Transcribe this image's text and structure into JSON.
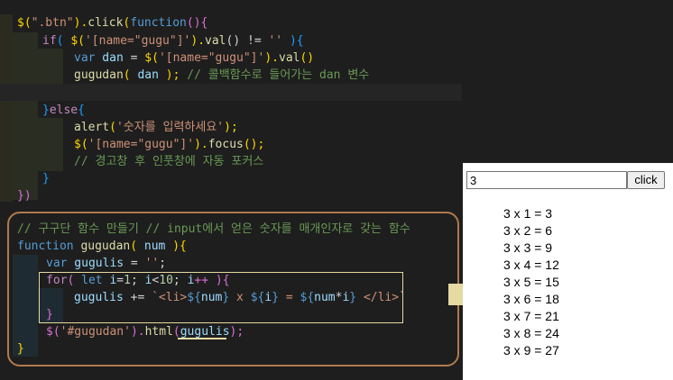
{
  "code": {
    "l1": {
      "p1": "$(",
      "p2": "\".btn\"",
      "p3": ").",
      "p4": "click",
      "p5": "(",
      "p6": "function",
      "p7": "(){"
    },
    "l2": {
      "p1": "if",
      "p2": "( ",
      "p3": "$(",
      "p4": "'[name=\"gugu\"]'",
      "p5": ").",
      "p6": "val",
      "p7": "() != ",
      "p8": "''",
      "p9": " ){"
    },
    "l3": {
      "p1": "var",
      "p2": " dan",
      "p3": " = ",
      "p4": "$(",
      "p5": "'[name=\"gugu\"]'",
      "p6": ").",
      "p7": "val",
      "p8": "()"
    },
    "l4": {
      "p1": "gugudan",
      "p2": "( ",
      "p3": "dan",
      "p4": " ); ",
      "p5": "// 콜백함수로 들어가는 dan 변수"
    },
    "l6": {
      "p1": "}",
      "p2": "else",
      "p3": "{"
    },
    "l7": {
      "p1": "alert",
      "p2": "(",
      "p3": "'숫자를 입력하세요'",
      "p4": ");"
    },
    "l8": {
      "p1": "$(",
      "p2": "'[name=\"gugu\"]'",
      "p3": ").",
      "p4": "focus",
      "p5": "();"
    },
    "l9": {
      "p1": "// 경고창 후 인풋창에 자동 포커스"
    },
    "l10": {
      "p1": "}"
    },
    "l11": {
      "p1": "})"
    },
    "l13": {
      "p1": "// 구구단 함수 만들기 // input에서 얻은 숫자를 매개인자로 갖는 함수"
    },
    "l14": {
      "p1": "function",
      "p2": " gugudan",
      "p3": "( ",
      "p4": "num",
      "p5": " )",
      "p6": "{"
    },
    "l15": {
      "p1": "var",
      "p2": " gugulis",
      "p3": " = ",
      "p4": "''",
      "p5": ";"
    },
    "l16": {
      "p1": "for",
      "p2": "( ",
      "p3": "let",
      "p4": " i",
      "p5": "=",
      "p6": "1",
      "p7": "; ",
      "p8": "i",
      "p9": "<",
      "p10": "10",
      "p11": "; ",
      "p12": "i",
      "p13": "++ ){"
    },
    "l17": {
      "p1": "gugulis",
      "p2": " += ",
      "p3": "`<li>",
      "p4": "${",
      "p5": "num",
      "p6": "}",
      "p7": " x ",
      "p8": "${",
      "p9": "i",
      "p10": "}",
      "p11": " = ",
      "p12": "${",
      "p13": "num",
      "p14": "*",
      "p15": "i",
      "p16": "}",
      "p17": " </li>`"
    },
    "l18": {
      "p1": "}"
    },
    "l19": {
      "p1": "$(",
      "p2": "'#gugudan'",
      "p3": ").",
      "p4": "html",
      "p5": "(",
      "p6": "gugulis",
      "p7": ");"
    },
    "l20": {
      "p1": "}"
    }
  },
  "result": {
    "input_value": "3",
    "button_label": "click",
    "items": [
      "3 x 1 = 3",
      "3 x 2 = 6",
      "3 x 3 = 9",
      "3 x 4 = 12",
      "3 x 5 = 15",
      "3 x 6 = 18",
      "3 x 7 = 21",
      "3 x 8 = 24",
      "3 x 9 = 27"
    ]
  },
  "colors": {
    "editor_bg": "#1e1e1e",
    "keyword": "#569cd6",
    "string": "#ce9178",
    "comment": "#6a9955",
    "function": "#dcdcaa",
    "highlight_box_orange": "#b07a4c",
    "highlight_box_yellow": "#e6d9a1",
    "arrow": "#e6d9a1"
  }
}
